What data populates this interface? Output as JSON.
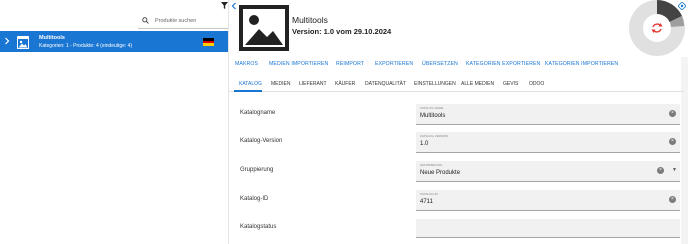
{
  "left": {
    "search_placeholder": "Produkte suchen",
    "category": {
      "name": "Multitools",
      "subtitle": "Kategorien: 1 - Produkte: 4 (eindeutige: 4)"
    }
  },
  "header": {
    "title": "Multitools",
    "version": "Version: 1.0 vom 29.10.2024"
  },
  "actions": [
    "MAKROS",
    "MEDIEN IMPORTIEREN",
    "REIMPORT",
    "EXPORTIEREN",
    "ÜBERSETZEN",
    "KATEGORIEN EXPORTIEREN",
    "KATEGORIEN IMPORTIEREN"
  ],
  "tabs": [
    "KATALOG",
    "MEDIEN",
    "LIEFERANT",
    "KÄUFER",
    "DATENQUALITÄT",
    "EINSTELLUNGEN",
    "ALLE MEDIEN",
    "GEVIS",
    "ODOO"
  ],
  "form": [
    {
      "label": "Katalogname",
      "caption": "KATALOG-NAME",
      "value": "Multitools",
      "control": "clear"
    },
    {
      "label": "Katalog-Version",
      "caption": "KATALOG-VERSION",
      "value": "1.0",
      "control": "clear"
    },
    {
      "label": "Gruppierung",
      "caption": "GRUPPIERUNG",
      "value": "Neue Produkte",
      "control": "clear-dropdown"
    },
    {
      "label": "Katalog-ID",
      "caption": "KATALOG-ID",
      "value": "4711",
      "control": "clear"
    },
    {
      "label": "Katalogstatus",
      "caption": "",
      "value": "",
      "control": "none"
    }
  ],
  "colors": {
    "accent": "#1976d2",
    "progress_gray": "#444444",
    "progress_light": "#e0e0e0",
    "refresh_red": "#e53935"
  }
}
